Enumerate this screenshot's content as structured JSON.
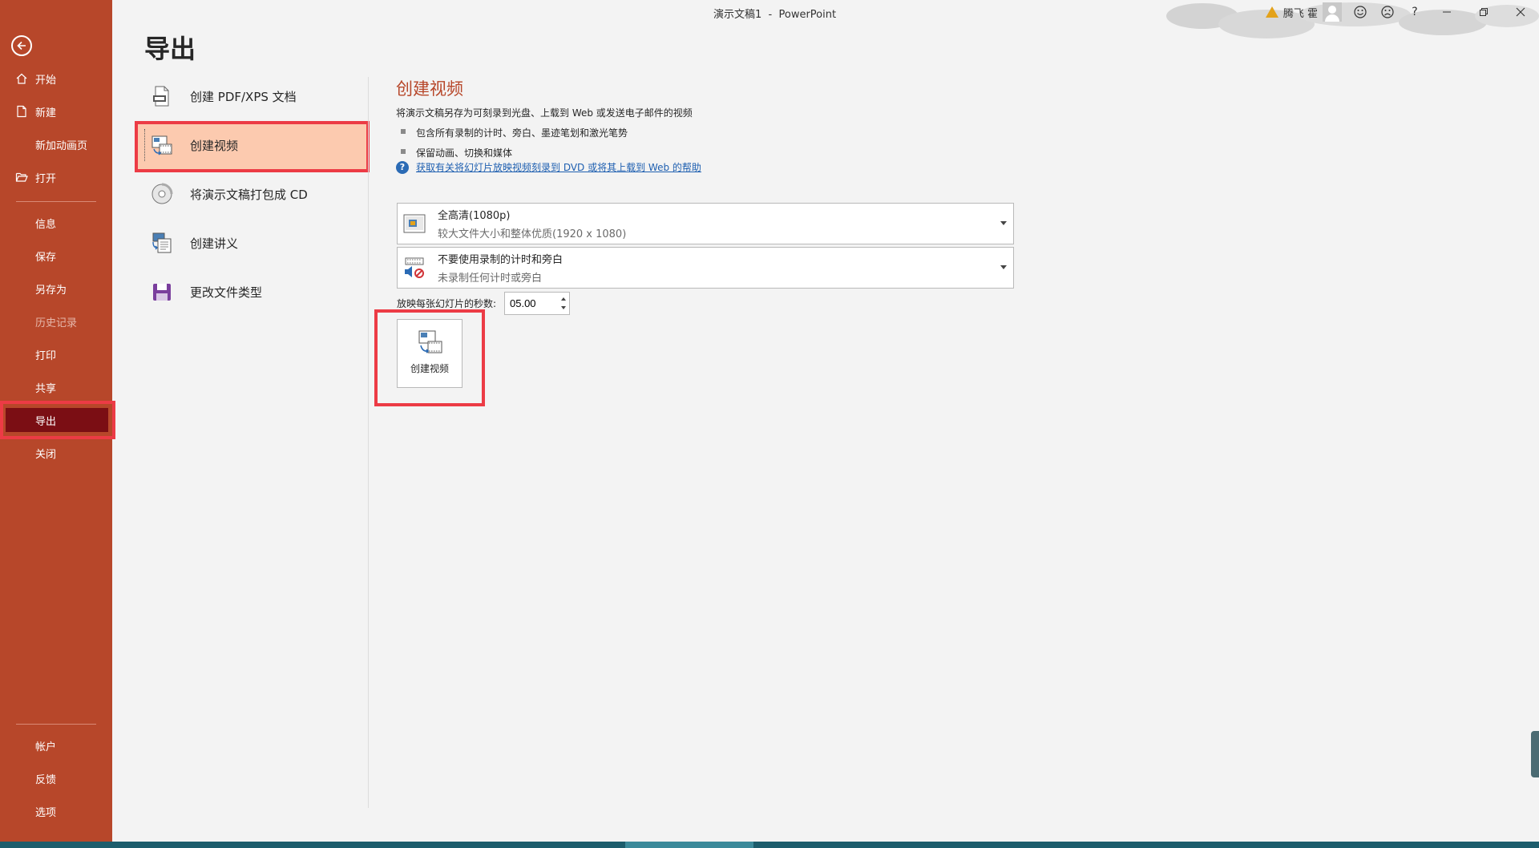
{
  "window": {
    "title": "演示文稿1  -  PowerPoint",
    "user_name": "腾飞 霍",
    "help_label": "?"
  },
  "nav": {
    "back_label": "返回",
    "items": [
      {
        "label": "开始"
      },
      {
        "label": "新建"
      },
      {
        "label": "新加动画页"
      },
      {
        "label": "打开"
      },
      {
        "label": "信息"
      },
      {
        "label": "保存"
      },
      {
        "label": "另存为"
      },
      {
        "label": "历史记录"
      },
      {
        "label": "打印"
      },
      {
        "label": "共享"
      },
      {
        "label": "导出"
      },
      {
        "label": "关闭"
      },
      {
        "label": "帐户"
      },
      {
        "label": "反馈"
      },
      {
        "label": "选项"
      }
    ],
    "active": "导出"
  },
  "page_title": "导出",
  "options": [
    {
      "label": "创建 PDF/XPS 文档",
      "icon": "pdf-document-icon"
    },
    {
      "label": "创建视频",
      "icon": "video-icon"
    },
    {
      "label": "将演示文稿打包成 CD",
      "icon": "cd-icon"
    },
    {
      "label": "创建讲义",
      "icon": "handout-icon"
    },
    {
      "label": "更改文件类型",
      "icon": "file-type-icon"
    }
  ],
  "selected_option": "创建视频",
  "detail": {
    "heading": "创建视频",
    "description": "将演示文稿另存为可刻录到光盘、上载到 Web 或发送电子邮件的视频",
    "bullets": [
      "包含所有录制的计时、旁白、墨迹笔划和激光笔势",
      "保留动画、切换和媒体"
    ],
    "help_link": "获取有关将幻灯片放映视频刻录到 DVD 或将其上载到 Web 的帮助",
    "quality": {
      "title": "全高清(1080p)",
      "subtitle": "较大文件大小和整体优质(1920 x 1080)"
    },
    "timing": {
      "title": "不要使用录制的计时和旁白",
      "subtitle": "未录制任何计时或旁白"
    },
    "seconds_label": "放映每张幻灯片的秒数:",
    "seconds_value": "05.00",
    "create_button": "创建视频"
  },
  "colors": {
    "rail": "#b7472a",
    "rail_active": "#7b0e14",
    "selected_option": "#fccaaf",
    "highlight_box": "#ec3b45",
    "link": "#1e5fb0"
  }
}
